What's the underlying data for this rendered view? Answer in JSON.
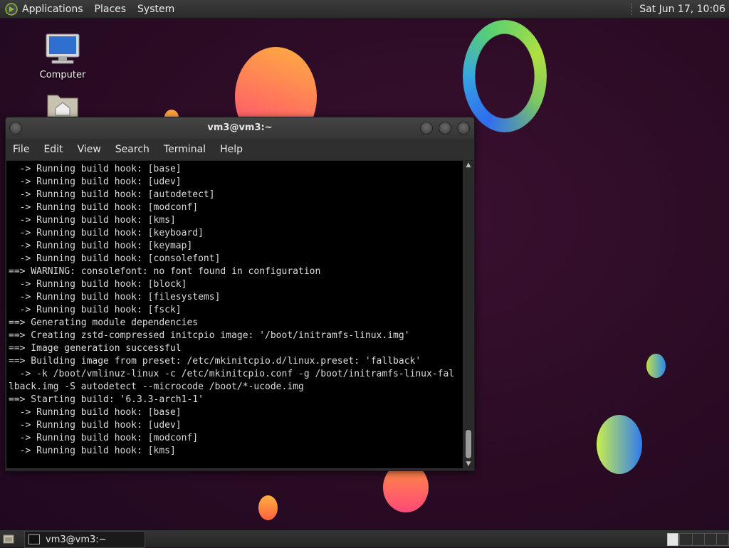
{
  "top_panel": {
    "menus": [
      "Applications",
      "Places",
      "System"
    ],
    "clock": "Sat Jun 17, 10:06"
  },
  "desktop": {
    "icons": [
      {
        "label": "Computer",
        "icon": "computer-icon"
      },
      {
        "label": "",
        "icon": "home-folder-icon"
      }
    ]
  },
  "terminal_window": {
    "title": "vm3@vm3:~",
    "menu": [
      "File",
      "Edit",
      "View",
      "Search",
      "Terminal",
      "Help"
    ],
    "lines": [
      "  -> Running build hook: [base]",
      "  -> Running build hook: [udev]",
      "  -> Running build hook: [autodetect]",
      "  -> Running build hook: [modconf]",
      "  -> Running build hook: [kms]",
      "  -> Running build hook: [keyboard]",
      "  -> Running build hook: [keymap]",
      "  -> Running build hook: [consolefont]",
      "==> WARNING: consolefont: no font found in configuration",
      "  -> Running build hook: [block]",
      "  -> Running build hook: [filesystems]",
      "  -> Running build hook: [fsck]",
      "==> Generating module dependencies",
      "==> Creating zstd-compressed initcpio image: '/boot/initramfs-linux.img'",
      "==> Image generation successful",
      "==> Building image from preset: /etc/mkinitcpio.d/linux.preset: 'fallback'",
      "  -> -k /boot/vmlinuz-linux -c /etc/mkinitcpio.conf -g /boot/initramfs-linux-fal",
      "lback.img -S autodetect --microcode /boot/*-ucode.img",
      "==> Starting build: '6.3.3-arch1-1'",
      "  -> Running build hook: [base]",
      "  -> Running build hook: [udev]",
      "  -> Running build hook: [modconf]",
      "  -> Running build hook: [kms]"
    ]
  },
  "taskbar": {
    "task_label": "vm3@vm3:~"
  },
  "colors": {
    "desktop_bg": "#2a0b24",
    "panel_bg": "#2f2f2f",
    "terminal_bg": "#000000",
    "terminal_fg": "#dcdcdc"
  }
}
